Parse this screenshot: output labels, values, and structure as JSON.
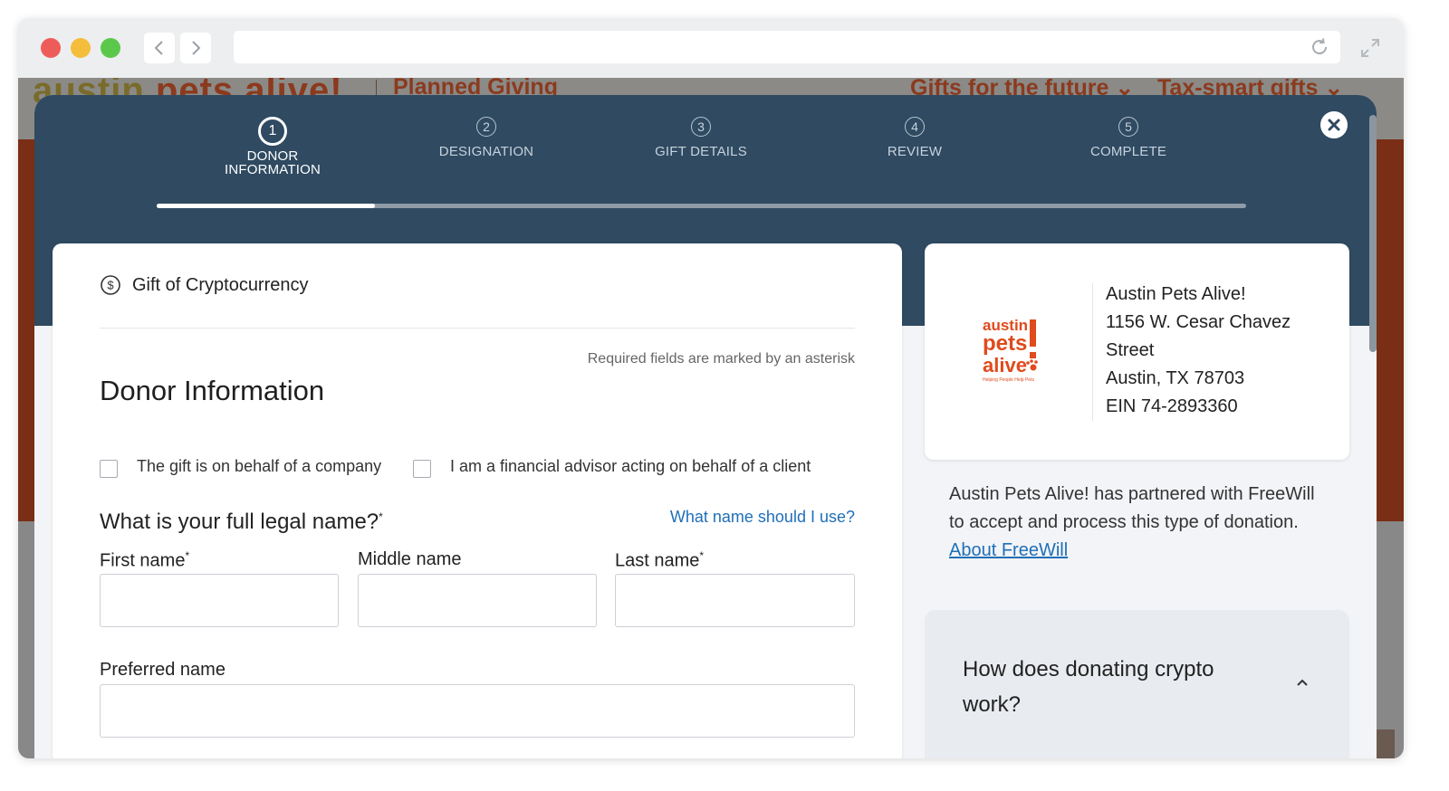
{
  "browser": {
    "url": ""
  },
  "site": {
    "logo_word1": "austin",
    "logo_word2": "pets alive!",
    "title": "Planned Giving",
    "nav": [
      "Gifts for the future",
      "Tax-smart gifts"
    ]
  },
  "steps": [
    {
      "num": "1",
      "label": "DONOR INFORMATION",
      "active": true
    },
    {
      "num": "2",
      "label": "DESIGNATION",
      "active": false
    },
    {
      "num": "3",
      "label": "GIFT DETAILS",
      "active": false
    },
    {
      "num": "4",
      "label": "REVIEW",
      "active": false
    },
    {
      "num": "5",
      "label": "COMPLETE",
      "active": false
    }
  ],
  "progress": 0.2,
  "form": {
    "gift_type": "Gift of Cryptocurrency",
    "required_note": "Required fields are marked by an asterisk",
    "section_title": "Donor Information",
    "checkbox_company": "The gift is on behalf of a company",
    "checkbox_advisor": "I am a financial advisor acting on behalf of a client",
    "name_question": "What is your full legal name?",
    "name_help": "What name should I use?",
    "first_name_label": "First name",
    "middle_name_label": "Middle name",
    "last_name_label": "Last name",
    "preferred_name_label": "Preferred name",
    "first_name_value": "",
    "middle_name_value": "",
    "last_name_value": "",
    "preferred_name_value": "",
    "asterisk": "*"
  },
  "org": {
    "name": "Austin Pets Alive!",
    "address1": "1156 W. Cesar Chavez",
    "address2": "Street",
    "city": "Austin, TX 78703",
    "ein": "EIN 74-2893360",
    "logo_line1": "austin",
    "logo_line2": "pets",
    "logo_line3": "alive",
    "logo_tagline": "Helping People Help Pets"
  },
  "partner": {
    "text": "Austin Pets Alive! has partnered with FreeWill to accept and process this type of donation. ",
    "link": "About FreeWill"
  },
  "faq": {
    "question": "How does donating crypto work?"
  },
  "colors": {
    "modal_header": "#2f4a61",
    "link": "#1f6fb8",
    "logo_orange": "#e04a1d",
    "logo_green": "#8dc63f"
  }
}
